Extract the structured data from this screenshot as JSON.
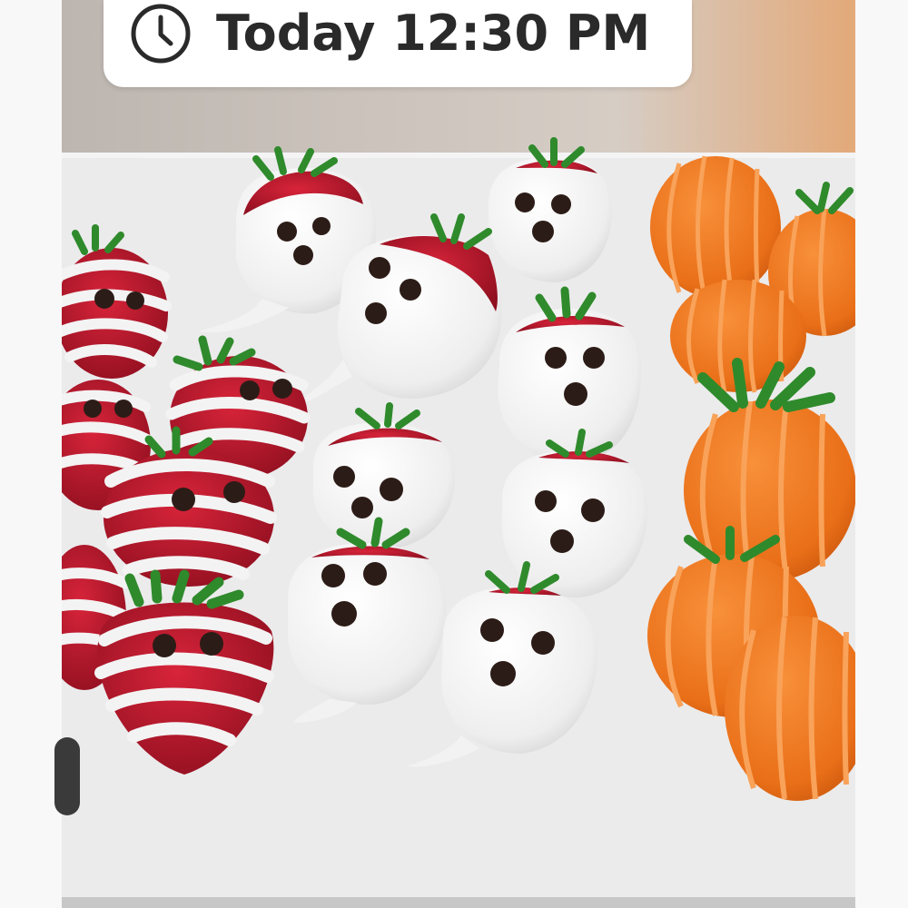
{
  "time_pill": {
    "icon": "clock-icon",
    "label": "Today 12:30 PM"
  },
  "photo": {
    "icon": "food-photo"
  },
  "colors": {
    "pill_bg": "#ffffff",
    "text": "#2a2a2a",
    "pumpkin": "#ee7a22",
    "ghost": "#f7f7f7",
    "strawberry": "#b5162a"
  }
}
